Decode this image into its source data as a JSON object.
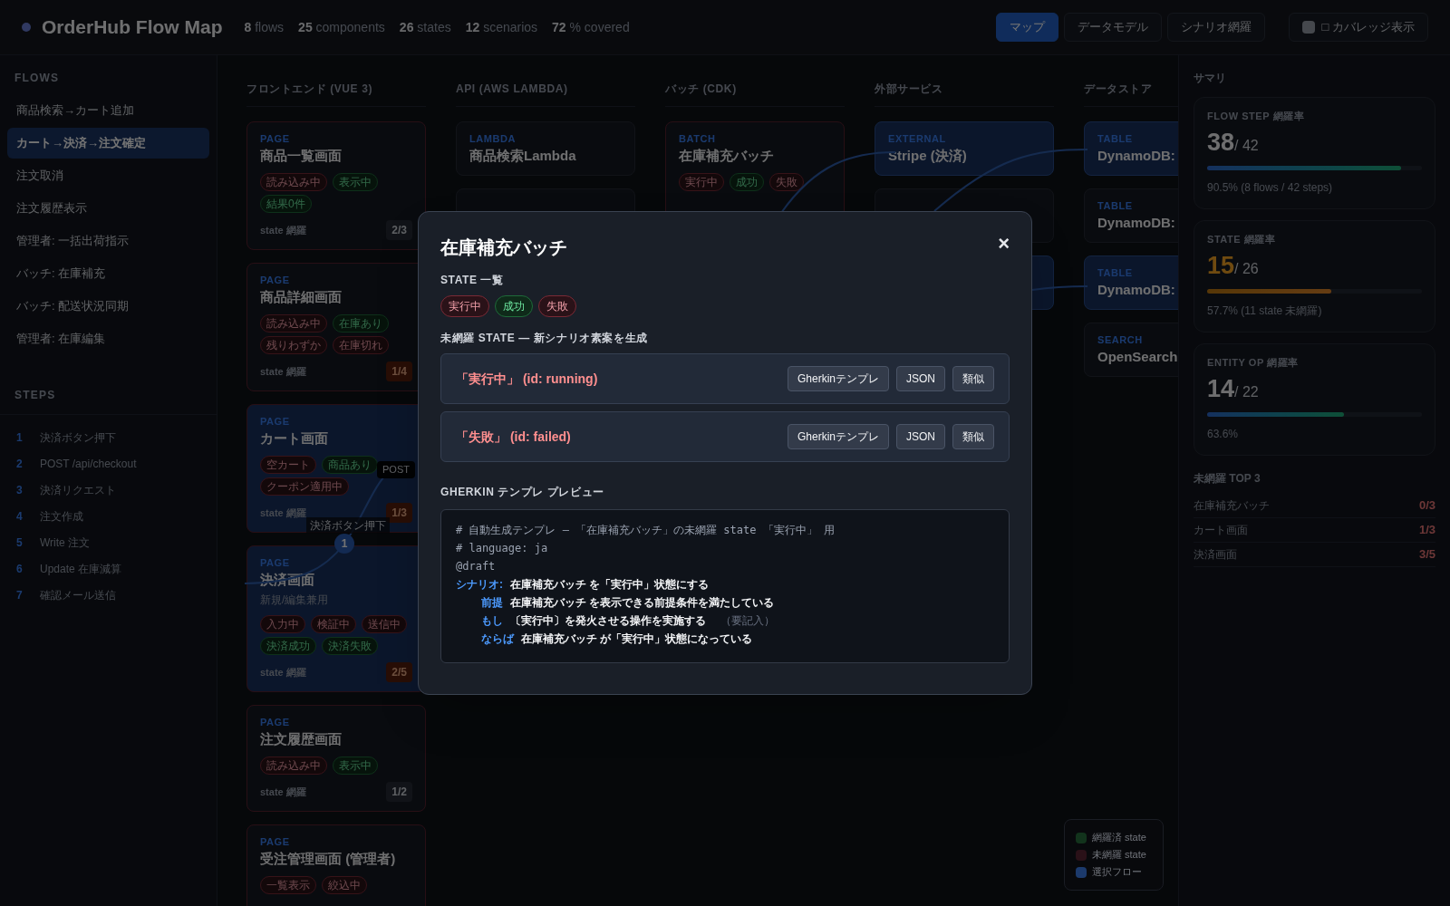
{
  "header": {
    "title": "OrderHub Flow Map",
    "stats": [
      "**8** flows",
      "**25** components",
      "**26** states",
      "**12** scenarios",
      "**72** % covered"
    ],
    "tabs": [
      {
        "label": "マップ",
        "selected": true
      },
      {
        "label": "データモデル",
        "selected": false
      },
      {
        "label": "シナリオ網羅",
        "selected": false
      }
    ],
    "coverage_toggle": {
      "label": "□ カバレッジ表示",
      "checked": false
    }
  },
  "sidebar": {
    "flows_heading": "FLOWS",
    "flows": [
      {
        "label": "商品検索→カート追加",
        "selected": false
      },
      {
        "label": "カート→決済→注文確定",
        "selected": true
      },
      {
        "label": "注文取消",
        "selected": false
      },
      {
        "label": "注文履歴表示",
        "selected": false
      },
      {
        "label": "管理者: 一括出荷指示",
        "selected": false
      },
      {
        "label": "バッチ: 在庫補充",
        "selected": false
      },
      {
        "label": "バッチ: 配送状況同期",
        "selected": false
      },
      {
        "label": "管理者: 在庫編集",
        "selected": false
      }
    ],
    "steps_heading": "STEPS",
    "steps": [
      {
        "number": "1",
        "label": "決済ボタン押下"
      },
      {
        "number": "2",
        "label": "POST /api/checkout"
      },
      {
        "number": "3",
        "label": "決済リクエスト"
      },
      {
        "number": "4",
        "label": "注文作成"
      },
      {
        "number": "5",
        "label": "Write 注文"
      },
      {
        "number": "6",
        "label": "Update 在庫減算"
      },
      {
        "number": "7",
        "label": "確認メール送信"
      }
    ]
  },
  "canvas": {
    "columns": [
      {
        "heading": "フロントエンド (VUE 3)",
        "cards": [
          {
            "kind_label": "PAGE",
            "title": "商品一覧画面",
            "in_flow": false,
            "states": [
              {
                "label": "読み込み中",
                "covered": false
              },
              {
                "label": "表示中",
                "covered": true
              },
              {
                "label": "結果0件",
                "covered": true
              }
            ],
            "footer": "state 網羅",
            "count": "2/3",
            "alert": false
          },
          {
            "kind_label": "PAGE",
            "title": "商品詳細画面",
            "in_flow": false,
            "states": [
              {
                "label": "読み込み中",
                "covered": false
              },
              {
                "label": "在庫あり",
                "covered": true
              },
              {
                "label": "残りわずか",
                "covered": false
              },
              {
                "label": "在庫切れ",
                "covered": false
              }
            ],
            "footer": "state 網羅",
            "count": "1/4",
            "alert": true
          },
          {
            "kind_label": "PAGE",
            "title": "カート画面",
            "in_flow": true,
            "states": [
              {
                "label": "空カート",
                "covered": false
              },
              {
                "label": "商品あり",
                "covered": true
              },
              {
                "label": "クーポン適用中",
                "covered": false
              }
            ],
            "footer": "state 網羅",
            "count": "1/3",
            "alert": true
          },
          {
            "kind_label": "PAGE",
            "title": "決済画面",
            "subtitle": "新規/編集兼用",
            "in_flow": true,
            "states": [
              {
                "label": "入力中",
                "covered": false
              },
              {
                "label": "検証中",
                "covered": false
              },
              {
                "label": "送信中",
                "covered": false
              },
              {
                "label": "決済成功",
                "covered": true
              },
              {
                "label": "決済失敗",
                "covered": true
              }
            ],
            "footer": "state 網羅",
            "count": "2/5",
            "alert": true
          },
          {
            "kind_label": "PAGE",
            "title": "注文履歴画面",
            "in_flow": false,
            "states": [
              {
                "label": "読み込み中",
                "covered": false
              },
              {
                "label": "表示中",
                "covered": true
              }
            ],
            "footer": "state 網羅",
            "count": "1/2",
            "alert": false
          },
          {
            "kind_label": "PAGE",
            "title": "受注管理画面 (管理者)",
            "in_flow": false,
            "states": [
              {
                "label": "一覧表示",
                "covered": false
              },
              {
                "label": "絞込中",
                "covered": false
              }
            ]
          }
        ]
      },
      {
        "heading": "API (AWS LAMBDA)",
        "cards": [
          {
            "kind_label": "LAMBDA",
            "title": "商品検索Lambda",
            "in_flow": false
          },
          {
            "in_flow": false
          }
        ]
      },
      {
        "heading": "バッチ (CDK)",
        "cards": [
          {
            "kind_label": "BATCH",
            "title": "在庫補充バッチ",
            "in_flow": false,
            "states": [
              {
                "label": "実行中",
                "covered": false
              },
              {
                "label": "成功",
                "covered": true
              },
              {
                "label": "失敗",
                "covered": false
              }
            ]
          }
        ]
      },
      {
        "heading": "外部サービス",
        "cards": [
          {
            "kind_label": "EXTERNAL",
            "title": "Stripe (決済)",
            "in_flow": true
          },
          {
            "in_flow": false
          },
          {
            "in_flow": true
          }
        ]
      },
      {
        "heading": "データストア",
        "cards": [
          {
            "kind_label": "TABLE",
            "title": "DynamoDB:",
            "in_flow": true
          },
          {
            "kind_label": "TABLE",
            "title": "DynamoDB:",
            "in_flow": false
          },
          {
            "kind_label": "TABLE",
            "title": "DynamoDB:",
            "in_flow": true
          },
          {
            "kind_label": "SEARCH",
            "title": "OpenSearch",
            "in_flow": false
          }
        ]
      }
    ],
    "step_marker": {
      "number": "1",
      "label": "決済ボタン押下"
    },
    "edge_label": "POST",
    "legend": [
      {
        "label": "網羅済 state",
        "color": "#12331c"
      },
      {
        "label": "未網羅 state",
        "color": "#2a1118"
      },
      {
        "label": "選択フロー",
        "color": "#1c3a6c"
      }
    ]
  },
  "summary": {
    "heading": "サマリ",
    "metrics": [
      {
        "title": "FLOW STEP 網羅率",
        "value": "38",
        "total": "/ 42",
        "level": 0.905,
        "warn": false,
        "note": "90.5% (8 flows / 42 steps)"
      },
      {
        "title": "STATE 網羅率",
        "value": "15",
        "total": "/ 26",
        "level": 0.577,
        "warn": true,
        "note": "57.7% (11 state 未網羅)"
      },
      {
        "title": "ENTITY OP 網羅率",
        "value": "14",
        "total": "/ 22",
        "level": 0.636,
        "warn": false,
        "note": "63.6%"
      }
    ],
    "top_heading": "未網羅 TOP 3",
    "top": [
      {
        "name": "在庫補充バッチ",
        "count": "0/3"
      },
      {
        "name": "カート画面",
        "count": "1/3"
      },
      {
        "name": "決済画面",
        "count": "3/5"
      }
    ]
  },
  "modal": {
    "title": "在庫補充バッチ",
    "close": "×",
    "states_heading": "STATE 一覧",
    "states": [
      {
        "label": "実行中",
        "covered": false
      },
      {
        "label": "成功",
        "covered": true
      },
      {
        "label": "失敗",
        "covered": false
      }
    ],
    "uncovered_heading": "未網羅 STATE — 新シナリオ素案を生成",
    "uncovered": [
      {
        "label": "「実行中」 (id: running)",
        "buttons": [
          "Gherkinテンプレ",
          "JSON",
          "類似"
        ]
      },
      {
        "label": "「失敗」 (id: failed)",
        "buttons": [
          "Gherkinテンプレ",
          "JSON",
          "類似"
        ]
      }
    ],
    "preview_heading": "GHERKIN テンプレ プレビュー",
    "preview": [
      {
        "kind": "comment",
        "text": "# 自動生成テンプレ — 「在庫補充バッチ」の未網羅 state 「実行中」 用"
      },
      {
        "kind": "comment",
        "text": "# language: ja"
      },
      {
        "kind": "comment",
        "text": "@draft"
      },
      {
        "kind": "scenario",
        "keyword": "シナリオ:",
        "text": "在庫補充バッチ を「実行中」状態にする"
      },
      {
        "kind": "step",
        "keyword": "前提",
        "text": "在庫補充バッチ を表示できる前提条件を満たしている"
      },
      {
        "kind": "step",
        "keyword": "もし",
        "text": "〔実行中〕を発火させる操作を実施する",
        "note": "（要記入）"
      },
      {
        "kind": "step",
        "keyword": "ならば",
        "text": "在庫補充バッチ が「実行中」状態になっている"
      }
    ]
  }
}
